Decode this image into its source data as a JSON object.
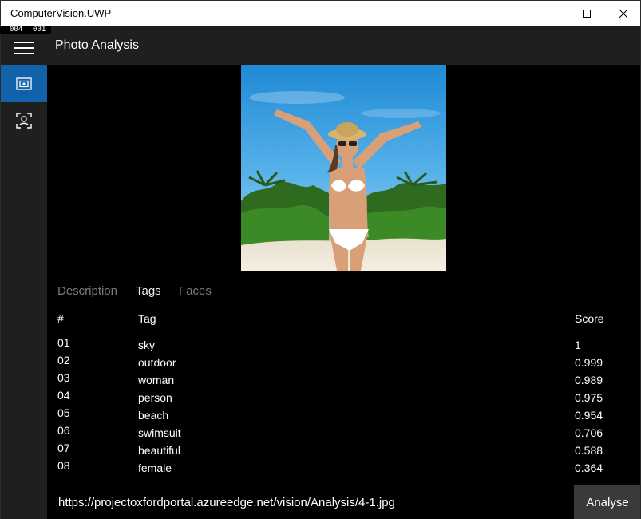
{
  "window": {
    "title": "ComputerVision.UWP",
    "fps_counter": [
      "004",
      "001"
    ]
  },
  "header": {
    "title": "Photo Analysis"
  },
  "sidebar": {
    "items": [
      {
        "icon": "photo-frame-icon",
        "active": true
      },
      {
        "icon": "face-scan-icon",
        "active": false
      }
    ]
  },
  "tabs": [
    {
      "label": "Description",
      "active": false
    },
    {
      "label": "Tags",
      "active": true
    },
    {
      "label": "Faces",
      "active": false
    }
  ],
  "table": {
    "columns": [
      "#",
      "Tag",
      "Score"
    ],
    "rows": [
      {
        "num": "01",
        "tag": "sky",
        "score": "1"
      },
      {
        "num": "02",
        "tag": "outdoor",
        "score": "0.999"
      },
      {
        "num": "03",
        "tag": "woman",
        "score": "0.989"
      },
      {
        "num": "04",
        "tag": "person",
        "score": "0.975"
      },
      {
        "num": "05",
        "tag": "beach",
        "score": "0.954"
      },
      {
        "num": "06",
        "tag": "swimsuit",
        "score": "0.706"
      },
      {
        "num": "07",
        "tag": "beautiful",
        "score": "0.588"
      },
      {
        "num": "08",
        "tag": "female",
        "score": "0.364"
      }
    ]
  },
  "url_bar": {
    "value": "https://projectoxfordportal.azureedge.net/vision/Analysis/4-1.jpg",
    "button_label": "Analyse"
  },
  "colors": {
    "accent": "#1162a8",
    "chrome": "#1f1f1f",
    "background": "#000000"
  }
}
